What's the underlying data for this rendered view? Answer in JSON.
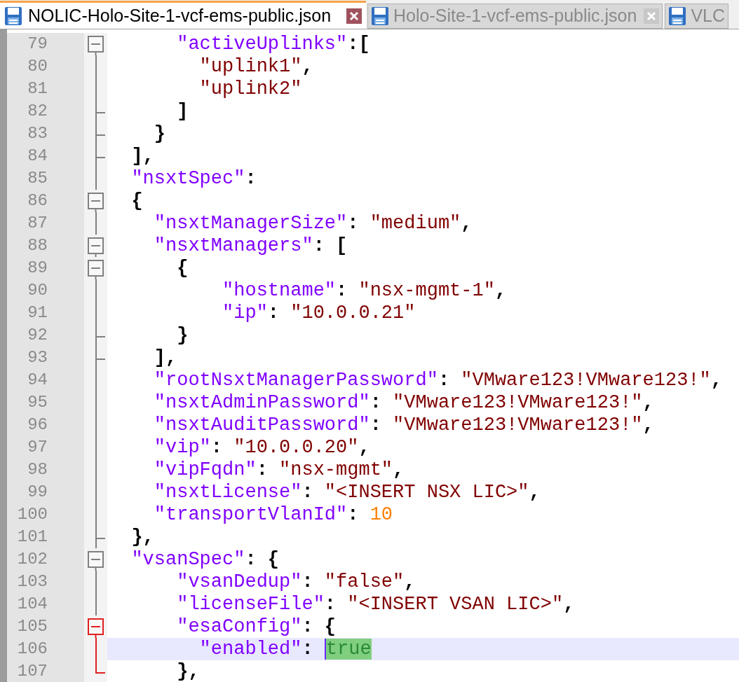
{
  "tabs": [
    {
      "label": "NOLIC-Holo-Site-1-vcf-ems-public.json",
      "selected": true
    },
    {
      "label": "Holo-Site-1-vcf-ems-public.json",
      "selected": false
    },
    {
      "label": "VLC",
      "selected": false
    }
  ],
  "lines": [
    {
      "number": "79",
      "kind": "fold_start",
      "fold_active": false,
      "current": false,
      "tokens": [
        {
          "kind": "key",
          "text": "      \"activeUplinks\""
        },
        {
          "kind": "punct",
          "text": ":["
        }
      ]
    },
    {
      "number": "80",
      "kind": "fold_body",
      "fold_active": false,
      "current": false,
      "tokens": [
        {
          "kind": "string",
          "text": "        \"uplink1\""
        },
        {
          "kind": "punct",
          "text": ","
        }
      ]
    },
    {
      "number": "81",
      "kind": "fold_body",
      "fold_active": false,
      "current": false,
      "tokens": [
        {
          "kind": "string",
          "text": "        \"uplink2\""
        }
      ]
    },
    {
      "number": "82",
      "kind": "fold_tick",
      "fold_active": false,
      "current": false,
      "tokens": [
        {
          "kind": "punct",
          "text": "      ]"
        }
      ]
    },
    {
      "number": "83",
      "kind": "fold_tick",
      "fold_active": false,
      "current": false,
      "tokens": [
        {
          "kind": "punct",
          "text": "    }"
        }
      ]
    },
    {
      "number": "84",
      "kind": "fold_tick",
      "fold_active": false,
      "current": false,
      "tokens": [
        {
          "kind": "punct",
          "text": "  ],"
        }
      ]
    },
    {
      "number": "85",
      "kind": "fold_body",
      "fold_active": false,
      "current": false,
      "tokens": [
        {
          "kind": "key",
          "text": "  \"nsxtSpec\""
        },
        {
          "kind": "punct",
          "text": ":"
        }
      ]
    },
    {
      "number": "86",
      "kind": "fold_start",
      "fold_active": false,
      "current": false,
      "tokens": [
        {
          "kind": "punct",
          "text": "  {"
        }
      ]
    },
    {
      "number": "87",
      "kind": "fold_body",
      "fold_active": false,
      "current": false,
      "tokens": [
        {
          "kind": "key",
          "text": "    \"nsxtManagerSize\""
        },
        {
          "kind": "punct",
          "text": ": "
        },
        {
          "kind": "string",
          "text": "\"medium\""
        },
        {
          "kind": "punct",
          "text": ","
        }
      ]
    },
    {
      "number": "88",
      "kind": "fold_start",
      "fold_active": false,
      "current": false,
      "tokens": [
        {
          "kind": "key",
          "text": "    \"nsxtManagers\""
        },
        {
          "kind": "punct",
          "text": ": ["
        }
      ]
    },
    {
      "number": "89",
      "kind": "fold_start",
      "fold_active": false,
      "current": false,
      "tokens": [
        {
          "kind": "punct",
          "text": "      {"
        }
      ]
    },
    {
      "number": "90",
      "kind": "fold_body",
      "fold_active": false,
      "current": false,
      "tokens": [
        {
          "kind": "key",
          "text": "          \"hostname\""
        },
        {
          "kind": "punct",
          "text": ": "
        },
        {
          "kind": "string",
          "text": "\"nsx-mgmt-1\""
        },
        {
          "kind": "punct",
          "text": ","
        }
      ]
    },
    {
      "number": "91",
      "kind": "fold_body",
      "fold_active": false,
      "current": false,
      "tokens": [
        {
          "kind": "key",
          "text": "          \"ip\""
        },
        {
          "kind": "punct",
          "text": ": "
        },
        {
          "kind": "string",
          "text": "\"10.0.0.21\""
        }
      ]
    },
    {
      "number": "92",
      "kind": "fold_tick",
      "fold_active": false,
      "current": false,
      "tokens": [
        {
          "kind": "punct",
          "text": "      }"
        }
      ]
    },
    {
      "number": "93",
      "kind": "fold_tick",
      "fold_active": false,
      "current": false,
      "tokens": [
        {
          "kind": "punct",
          "text": "    ],"
        }
      ]
    },
    {
      "number": "94",
      "kind": "fold_body",
      "fold_active": false,
      "current": false,
      "tokens": [
        {
          "kind": "key",
          "text": "    \"rootNsxtManagerPassword\""
        },
        {
          "kind": "punct",
          "text": ": "
        },
        {
          "kind": "string",
          "text": "\"VMware123!VMware123!\""
        },
        {
          "kind": "punct",
          "text": ","
        }
      ]
    },
    {
      "number": "95",
      "kind": "fold_body",
      "fold_active": false,
      "current": false,
      "tokens": [
        {
          "kind": "key",
          "text": "    \"nsxtAdminPassword\""
        },
        {
          "kind": "punct",
          "text": ": "
        },
        {
          "kind": "string",
          "text": "\"VMware123!VMware123!\""
        },
        {
          "kind": "punct",
          "text": ","
        }
      ]
    },
    {
      "number": "96",
      "kind": "fold_body",
      "fold_active": false,
      "current": false,
      "tokens": [
        {
          "kind": "key",
          "text": "    \"nsxtAuditPassword\""
        },
        {
          "kind": "punct",
          "text": ": "
        },
        {
          "kind": "string",
          "text": "\"VMware123!VMware123!\""
        },
        {
          "kind": "punct",
          "text": ","
        }
      ]
    },
    {
      "number": "97",
      "kind": "fold_body",
      "fold_active": false,
      "current": false,
      "tokens": [
        {
          "kind": "key",
          "text": "    \"vip\""
        },
        {
          "kind": "punct",
          "text": ": "
        },
        {
          "kind": "string",
          "text": "\"10.0.0.20\""
        },
        {
          "kind": "punct",
          "text": ","
        }
      ]
    },
    {
      "number": "98",
      "kind": "fold_body",
      "fold_active": false,
      "current": false,
      "tokens": [
        {
          "kind": "key",
          "text": "    \"vipFqdn\""
        },
        {
          "kind": "punct",
          "text": ": "
        },
        {
          "kind": "string",
          "text": "\"nsx-mgmt\""
        },
        {
          "kind": "punct",
          "text": ","
        }
      ]
    },
    {
      "number": "99",
      "kind": "fold_body",
      "fold_active": false,
      "current": false,
      "tokens": [
        {
          "kind": "key",
          "text": "    \"nsxtLicense\""
        },
        {
          "kind": "punct",
          "text": ": "
        },
        {
          "kind": "string",
          "text": "\"<INSERT NSX LIC>\""
        },
        {
          "kind": "punct",
          "text": ","
        }
      ]
    },
    {
      "number": "100",
      "kind": "fold_body",
      "fold_active": false,
      "current": false,
      "tokens": [
        {
          "kind": "key",
          "text": "    \"transportVlanId\""
        },
        {
          "kind": "punct",
          "text": ": "
        },
        {
          "kind": "number",
          "text": "10"
        }
      ]
    },
    {
      "number": "101",
      "kind": "fold_tick",
      "fold_active": false,
      "current": false,
      "tokens": [
        {
          "kind": "punct",
          "text": "  },"
        }
      ]
    },
    {
      "number": "102",
      "kind": "fold_start",
      "fold_active": false,
      "current": false,
      "tokens": [
        {
          "kind": "key",
          "text": "  \"vsanSpec\""
        },
        {
          "kind": "punct",
          "text": ": {"
        }
      ]
    },
    {
      "number": "103",
      "kind": "fold_body",
      "fold_active": false,
      "current": false,
      "tokens": [
        {
          "kind": "key",
          "text": "      \"vsanDedup\""
        },
        {
          "kind": "punct",
          "text": ": "
        },
        {
          "kind": "string",
          "text": "\"false\""
        },
        {
          "kind": "punct",
          "text": ","
        }
      ]
    },
    {
      "number": "104",
      "kind": "fold_body",
      "fold_active": false,
      "current": false,
      "tokens": [
        {
          "kind": "key",
          "text": "      \"licenseFile\""
        },
        {
          "kind": "punct",
          "text": ": "
        },
        {
          "kind": "string",
          "text": "\"<INSERT VSAN LIC>\""
        },
        {
          "kind": "punct",
          "text": ","
        }
      ]
    },
    {
      "number": "105",
      "kind": "fold_start",
      "fold_active": true,
      "current": false,
      "tokens": [
        {
          "kind": "key",
          "text": "      \"esaConfig\""
        },
        {
          "kind": "punct",
          "text": ": {"
        }
      ]
    },
    {
      "number": "106",
      "kind": "fold_body",
      "fold_active": true,
      "current": true,
      "tokens": [
        {
          "kind": "key",
          "text": "        \"enabled\""
        },
        {
          "kind": "punct",
          "text": ": "
        },
        {
          "kind": "matched_literal",
          "text": "true"
        }
      ]
    },
    {
      "number": "107",
      "kind": "fold_end",
      "fold_active": true,
      "current": false,
      "tokens": [
        {
          "kind": "punct",
          "text": "      },"
        }
      ]
    }
  ]
}
